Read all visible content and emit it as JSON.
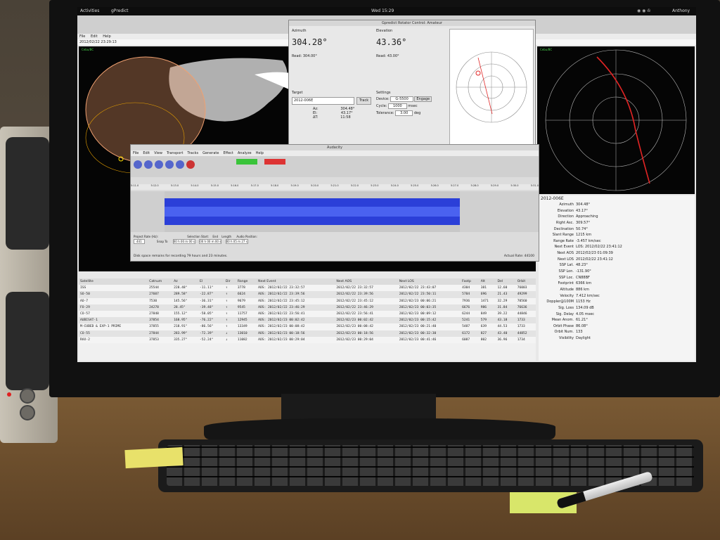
{
  "topbar": {
    "activities": "Activities",
    "app": "gPredict",
    "clock": "Wed 15:29",
    "user": "Anthony"
  },
  "main_window": {
    "menu": [
      "File",
      "Edit",
      "Help"
    ],
    "timestamp": "2012/02/22 23:29:13",
    "map_label": "Cebu/BC"
  },
  "rotator": {
    "title": "Gpredict Rotator Control: Amateur",
    "azimuth_label": "Azimuth",
    "azimuth_value": "304.28°",
    "azimuth_read": "Read:  304.00°",
    "elevation_label": "Elevation",
    "elevation_value": "43.36°",
    "elevation_read": "Read:  43.00°",
    "target_label": "Target",
    "target_value": "2012-006E",
    "track_button": "Track",
    "az_label": "Az:",
    "az_value": "304.48°",
    "el_label": "El:",
    "el_value": "43.17°",
    "dt_label": "ΔT:",
    "dt_value": "11:58",
    "settings_label": "Settings",
    "device_label": "Device:",
    "device_value": "G-5500",
    "engage_button": "Engage",
    "cycle_label": "Cycle:",
    "cycle_value": "1000",
    "cycle_unit": "msec",
    "tolerance_label": "Tolerance:",
    "tolerance_value": "3.00",
    "tolerance_unit": "deg"
  },
  "audio": {
    "title": "Audacity",
    "menu": [
      "File",
      "Edit",
      "View",
      "Transport",
      "Tracks",
      "Generate",
      "Effect",
      "Analyze",
      "Help"
    ],
    "ruler": [
      "5:11.0",
      "5:12.0",
      "5:13.0",
      "5:14.0",
      "5:15.0",
      "5:16.0",
      "5:17.0",
      "5:18.0",
      "5:19.0",
      "5:20.0",
      "5:21.0",
      "5:22.0",
      "5:23.0",
      "5:24.0",
      "5:25.0",
      "5:26.0",
      "5:27.0",
      "5:28.0",
      "5:29.0",
      "5:30.0",
      "5:31.0"
    ],
    "project_rate_label": "Project Rate (Hz):",
    "project_rate": "441",
    "snap_label": "Snap To",
    "selection_start_label": "Selection Start:",
    "end_label": "End",
    "length_label": "Length",
    "audio_position_label": "Audio Position:",
    "time_1": "00 h 00 m 00 s",
    "time_2": "00 h 00 m 00 s",
    "time_3": "00 h 05 m 27 s",
    "status": "Disk space remains for recording 79 hours and 23 minutes.",
    "actual_rate": "Actual Rate: 44100"
  },
  "table": {
    "headers": [
      "Satellite",
      "Catnum",
      "Az",
      "El",
      "Dir",
      "Range",
      "Next Event",
      "Next AOS",
      "Next LOS",
      "Footp",
      "Alt",
      "Del",
      "Orbit"
    ],
    "rows": [
      [
        "ISS",
        "25544",
        "228.48°",
        "-11.11°",
        "↑",
        "3778",
        "AOS: 2012/02/22 23:32:57",
        "2012/02/22 23:32:57",
        "2012/02/22 23:43:07",
        "4304",
        "381",
        "12.60",
        "76003"
      ],
      [
        "SO-50",
        "27607",
        "289.58°",
        "-22.87°",
        "↑",
        "6624",
        "AOS: 2012/02/22 23:39:56",
        "2012/02/22 23:39:56",
        "2012/02/22 23:50:11",
        "5704",
        "696",
        "21.43",
        "49299"
      ],
      [
        "AO-7",
        "7530",
        "145.56°",
        "-36.31°",
        "↑",
        "9679",
        "AOS: 2012/02/22 23:45:12",
        "2012/02/22 23:45:12",
        "2012/02/23 00:06:21",
        "7936",
        "1471",
        "32.29",
        "70560"
      ],
      [
        "FO-29",
        "24278",
        "28.45°",
        "-39.48°",
        "↑",
        "9545",
        "AOS: 2012/02/22 23:46:29",
        "2012/02/22 23:46:29",
        "2012/02/23 00:03:35",
        "6676",
        "986",
        "31.84",
        "76636"
      ],
      [
        "CO-57",
        "27848",
        "155.12°",
        "-58.05°",
        "↑",
        "11757",
        "AOS: 2012/02/22 23:56:41",
        "2012/02/22 23:56:41",
        "2012/02/23 00:09:12",
        "6244",
        "849",
        "39.22",
        "44846"
      ],
      [
        "AUBISAT-1",
        "37854",
        "168.95°",
        "-76.22°",
        "↑",
        "12945",
        "AOS: 2012/02/23 00:02:42",
        "2012/02/23 00:02:42",
        "2012/02/23 00:15:42",
        "5241",
        "579",
        "43.18",
        "1733"
      ],
      [
        "M-CUBED & EXP-1 PRIME",
        "37855",
        "218.91°",
        "-86.56°",
        "↑",
        "13349",
        "AOS: 2012/02/23 00:08:42",
        "2012/02/23 00:08:42",
        "2012/02/23 00:21:40",
        "5487",
        "639",
        "44.53",
        "1733"
      ],
      [
        "CO-55",
        "27844",
        "283.99°",
        "-72.39°",
        "↓",
        "13010",
        "AOS: 2012/02/23 00:18:56",
        "2012/02/23 00:18:56",
        "2012/02/23 00:32:30",
        "6172",
        "827",
        "43.40",
        "44852"
      ],
      [
        "RAX-2",
        "37853",
        "335.27°",
        "-52.24°",
        "↓",
        "11082",
        "AOS: 2012/02/23 00:29:04",
        "2012/02/23 00:29:04",
        "2012/02/23 00:41:46",
        "6087",
        "802",
        "36.96",
        "1734"
      ]
    ]
  },
  "sat_info": {
    "name": "2012-006E",
    "rows": [
      [
        "Azimuth",
        "304.48°"
      ],
      [
        "Elevation",
        "43.17°"
      ],
      [
        "Direction",
        "Approaching"
      ],
      [
        "Right Asc.",
        "309.57°"
      ],
      [
        "Declination",
        "50.74°"
      ],
      [
        "Slant Range",
        "1215 km"
      ],
      [
        "Range Rate",
        "-3.457 km/sec"
      ],
      [
        "Next Event",
        "LOS: 2012/02/22 23:41:12"
      ],
      [
        "Next AOS",
        "2012/02/23 01:09:39"
      ],
      [
        "Next LOS",
        "2012/02/22 23:41:12"
      ],
      [
        "SSP Lat.",
        "48.23°"
      ],
      [
        "SSP Lon.",
        "-131.90°"
      ],
      [
        "SSP Loc.",
        "CN88BF"
      ],
      [
        "Footprint",
        "6366 km"
      ],
      [
        "Altitude",
        "886 km"
      ],
      [
        "Velocity",
        "7.412 km/sec"
      ],
      [
        "Doppler@100M",
        "1153 Hz"
      ],
      [
        "Sig. Loss",
        "134.09 dB"
      ],
      [
        "Sig. Delay",
        "4.05 msec"
      ],
      [
        "Mean Anom.",
        "61.21°"
      ],
      [
        "Orbit Phase",
        "86.08°"
      ],
      [
        "Orbit Num.",
        "133"
      ],
      [
        "Visibility",
        "Daylight"
      ]
    ]
  },
  "polar_label": "Cebu/BC",
  "colors": {
    "wave": "#2b3fd8",
    "track": "#e02424",
    "map_bg": "#050505"
  }
}
